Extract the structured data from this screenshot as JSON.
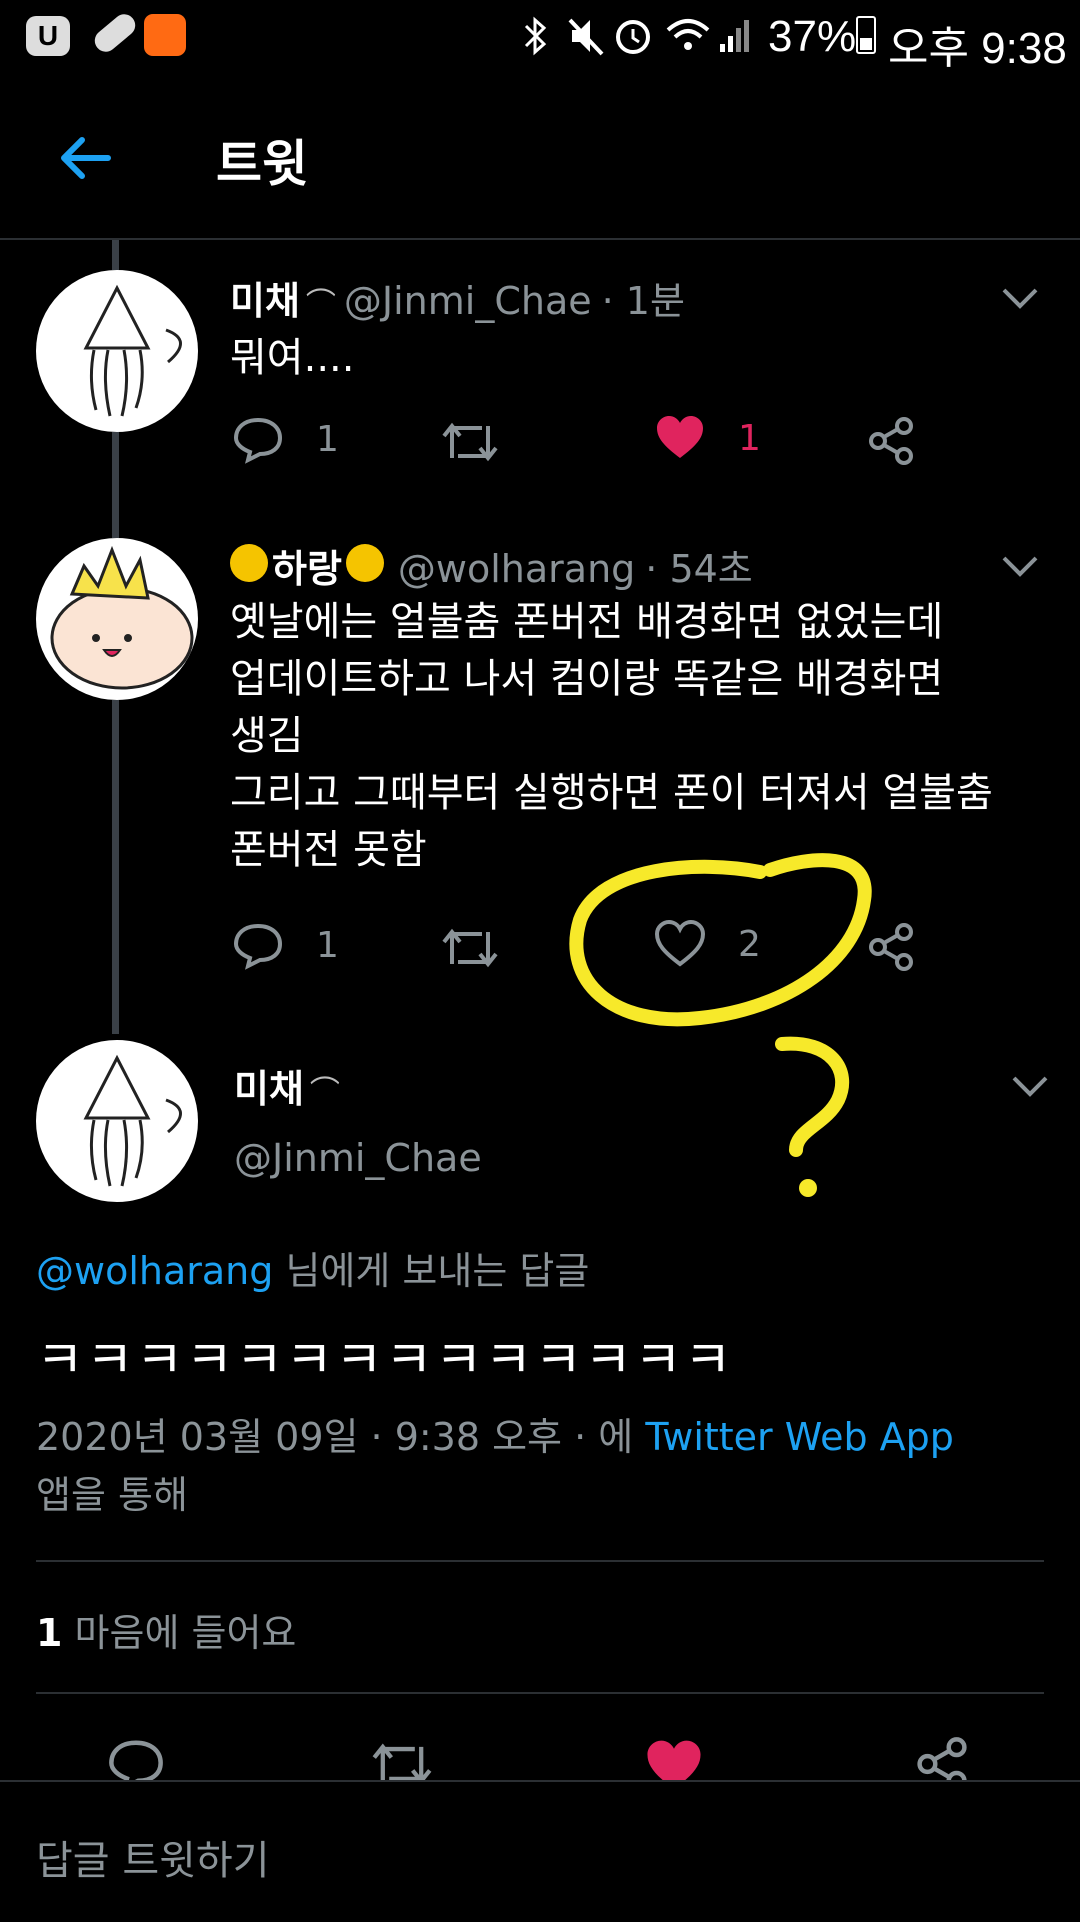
{
  "status_bar": {
    "battery": "37%",
    "time": "오후 9:38",
    "icons": [
      "u-plus-icon",
      "bandage-icon",
      "app-notification-icon",
      "bluetooth-icon",
      "mute-icon",
      "alarm-icon",
      "wifi-icon",
      "signal-icon",
      "battery-icon"
    ]
  },
  "header": {
    "title": "트윗",
    "back_icon": "back-arrow-icon"
  },
  "tweets": [
    {
      "name": "미채",
      "handle": "@Jinmi_Chae",
      "time": "· 1분",
      "text": "뭐여....",
      "reply_count": "1",
      "like_count": "1",
      "liked": true
    },
    {
      "name": "하랑",
      "handle": "@wolharang",
      "time": "· 54초",
      "lines": [
        "옛날에는 얼불춤 폰버전 배경화면 없었는데",
        "업데이트하고 나서 컴이랑 똑같은 배경화면",
        "생김",
        "그리고 그때부터 실행하면 폰이 터져서 얼불춤",
        "폰버전 못함"
      ],
      "reply_count": "1",
      "like_count": "2",
      "liked": false
    }
  ],
  "main_tweet": {
    "name": "미채",
    "handle": "@Jinmi_Chae",
    "reply_to_handle": "@wolharang",
    "reply_to_suffix": " 님에게 보내는 답글",
    "text": "ㅋㅋㅋㅋㅋㅋㅋㅋㅋㅋㅋㅋㅋㅋ",
    "timestamp": "2020년 03월 09일 · 9:38 오후 · 에 ",
    "source_app": "Twitter Web App",
    "source_suffix": "앱을 통해",
    "likes_count": "1",
    "likes_label": " 마음에 들어요"
  },
  "reply_bar": {
    "placeholder": "답글 트윗하기"
  },
  "colors": {
    "accent": "#1da1f2",
    "like": "#e0245e",
    "annotation": "#f7e92a"
  }
}
